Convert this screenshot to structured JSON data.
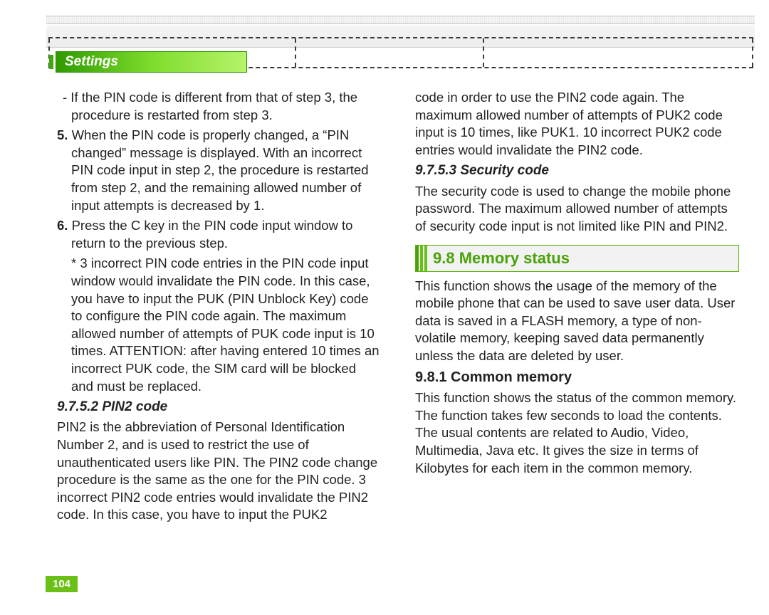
{
  "tab_label": "Settings",
  "page_number": "104",
  "col1": {
    "p1": "- If the PIN code is different from that of step 3, the procedure is restarted from step 3.",
    "p2_lead": "5.",
    "p2": " When the PIN code is properly changed, a “PIN changed” message is displayed. With an incorrect PIN code input in step 2, the procedure is restarted from step 2, and the remaining allowed number of input attempts is decreased by 1.",
    "p3_lead": "6.",
    "p3": " Press the C key in the PIN code input window to return to the previous step.",
    "p4": "* 3 incorrect PIN code entries in the PIN code input window would invalidate the PIN code. In this case, you have to input the PUK (PIN Unblock Key) code to configure the PIN code again. The maximum allowed number of attempts of PUK code input is 10 times. ATTENTION: after having entered 10 times an incorrect PUK code, the SIM card will be blocked and must be replaced.",
    "h1": "9.7.5.2 PIN2 code",
    "p5": "PIN2 is the abbreviation of Personal Identification Number 2, and is used to restrict the use of unauthenticated users like PIN. The PIN2 code change procedure is the same as the one for the PIN code. 3 incorrect PIN2 code entries would invalidate the PIN2 code. In this case, you have to input the PUK2"
  },
  "col2": {
    "p1": "code in order to use the PIN2 code again. The maximum allowed number of attempts of PUK2 code input is 10 times, like PUK1. 10 incorrect PUK2 code entries would invalidate the PIN2 code.",
    "h1": "9.7.5.3 Security code",
    "p2": "The security code is used to change the mobile phone password. The maximum allowed number of attempts of security code input is not limited like PIN and PIN2.",
    "section": "9.8 Memory status",
    "p3": "This function shows the usage of the memory of the mobile phone that can be used to save user data. User data is saved in a FLASH memory, a type of non-volatile memory, keeping saved data permanently unless the data are deleted by user.",
    "h2": "9.8.1 Common memory",
    "p4": "This function shows the status of the common memory. The function takes few seconds to load the contents. The usual contents are related to Audio, Video, Multimedia, Java etc. It gives the size in terms of Kilobytes for each item in the common memory."
  }
}
